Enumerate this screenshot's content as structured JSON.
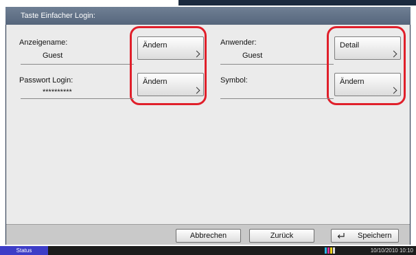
{
  "header": {
    "title": "Taste Einfacher Login:"
  },
  "fields": {
    "display_name": {
      "label": "Anzeigename:",
      "value": "Guest",
      "button_label": "Ändern"
    },
    "password_login": {
      "label": "Passwort Login:",
      "value": "**********",
      "button_label": "Ändern"
    },
    "user": {
      "label": "Anwender:",
      "value": "Guest",
      "button_label": "Detail"
    },
    "symbol": {
      "label": "Symbol:",
      "value": "",
      "button_label": "Ändern"
    }
  },
  "footer": {
    "cancel_label": "Abbrechen",
    "back_label": "Zurück",
    "save_label": "Speichern"
  },
  "statusbar": {
    "status_label": "Status",
    "datetime": "10/10/2010  10:10"
  },
  "colors": {
    "highlight": "#e01f2a",
    "status_tab": "#3d3dc7",
    "frame": "#1e2e45"
  },
  "icons": {
    "chevron": "chevron-right-icon",
    "save": "enter-arrow-icon",
    "toner": "toner-level-icon"
  }
}
